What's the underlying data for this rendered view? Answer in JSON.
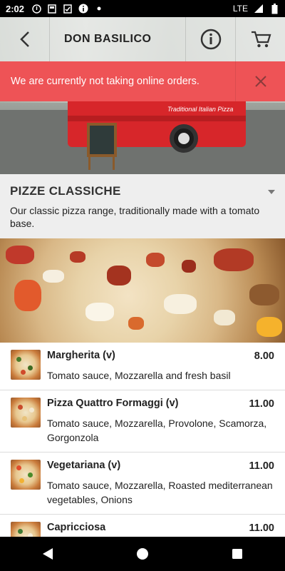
{
  "status_bar": {
    "time": "2:02",
    "network": "LTE"
  },
  "header": {
    "title": "DON BASILICO"
  },
  "truck_logo": "Traditional Italian Pizza",
  "notice": {
    "message": "We are currently not taking online orders."
  },
  "category": {
    "title": "PIZZE CLASSICHE",
    "description": "Our classic pizza range, traditionally made with a tomato base."
  },
  "items": [
    {
      "name": "Margherita (v)",
      "price": "8.00",
      "description": "Tomato sauce, Mozzarella and fresh basil"
    },
    {
      "name": "Pizza Quattro Formaggi (v)",
      "price": "11.00",
      "description": "Tomato sauce, Mozzarella, Provolone, Scamorza, Gorgonzola"
    },
    {
      "name": "Vegetariana (v)",
      "price": "11.00",
      "description": "Tomato sauce, Mozzarella, Roasted mediterranean vegetables, Onions"
    },
    {
      "name": "Capricciosa",
      "price": "11.00",
      "description": ""
    }
  ],
  "colors": {
    "notice_bg": "#ee5356",
    "category_bg": "#eeeeee",
    "accent_red": "#d7262a"
  },
  "icons": {
    "back": "chevron-left-icon",
    "info": "info-icon",
    "cart": "cart-icon",
    "close": "close-icon",
    "collapse": "caret-down-icon"
  }
}
